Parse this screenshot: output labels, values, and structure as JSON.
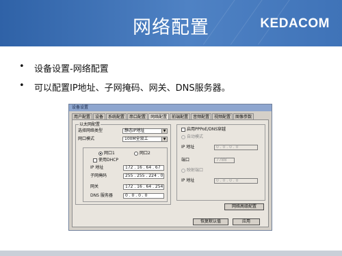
{
  "slide": {
    "title": "网络配置",
    "logo": "KEDACOM",
    "bullets": [
      "设备设置-网络配置",
      "可以配置IP地址、子网掩码、网关、DNS服务器。"
    ],
    "bullet_symbol": "•",
    "colors": {
      "header": "#3f73b8",
      "dialog_title": "#8ea6cf"
    }
  },
  "dialog": {
    "title": "设备设置",
    "tabs": [
      "用户配置",
      "设备",
      "系统配置",
      "串口配置",
      "网络配置",
      "前端配置",
      "音频配置",
      "视频配置",
      "图像参数"
    ],
    "active_tab": "网络配置",
    "left_group": {
      "title": "以太网配置",
      "select_net_type_label": "选择网络类型",
      "select_net_type_value": "静态IP地址",
      "port_mode_label": "网口模式",
      "port_mode_value": "100M全双工",
      "port1_label": "网口1",
      "port2_label": "网口2",
      "dhcp_label": "使用DHCP",
      "ip_label": "IP 地址",
      "ip_value": "172 . 16 . 64 . 67",
      "mask_label": "子网掩码",
      "mask_value": "255 . 255 . 224 . 0",
      "gateway_label": "网关",
      "gateway_value": "172 . 16 . 64 . 254",
      "dns_label": "DNS 服务器",
      "dns_value": "0 . 0 . 0 . 0"
    },
    "right_group": {
      "title": "",
      "pppoe_check_label": "启用PPPoE/DNS穿越",
      "auto_mode_label": "自动模式",
      "ip1_label": "IP 地址",
      "ip1_value": "0 . 0 . 0 . 0",
      "port_label": "端口",
      "port_value": "7788",
      "mapped_label": "映射端口",
      "ip2_label": "IP 地址",
      "ip2_value": "0 . 0 . 0 . 0",
      "advanced_button": "网络高级配置"
    },
    "buttons": {
      "restore": "恢复默认值",
      "apply": "应用"
    }
  }
}
